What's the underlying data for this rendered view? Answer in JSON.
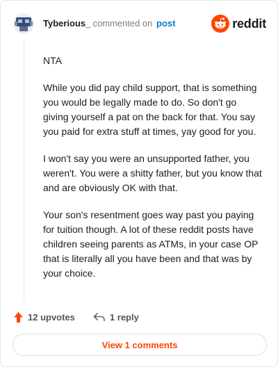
{
  "comment": {
    "username": "Tyberious_",
    "action_text": "commented on",
    "target_link": "post",
    "brand": "reddit",
    "paragraphs": [
      "NTA",
      "While you did pay child support, that is something you would be legally made to do. So don't go giving yourself a pat on the back for that. You say you paid for extra stuff at times, yay good for you.",
      "I won't say you were an unsupported father, you weren't. You were a shitty father, but you know that and are obviously OK with that.",
      "Your son's resentment goes way past you paying for tuition though. A lot of these reddit posts have children seeing parents as ATMs, in your case OP that is literally all you have been and that was by your choice."
    ]
  },
  "actions": {
    "upvotes": "12 upvotes",
    "replies": "1 reply",
    "view_comments": "View 1 comments"
  },
  "colors": {
    "accent": "#ff4500",
    "link": "#0079d3"
  },
  "icons": {
    "upvote": "upvote-arrow-icon",
    "reply": "reply-arrow-icon",
    "brand": "reddit-snoo-icon"
  }
}
